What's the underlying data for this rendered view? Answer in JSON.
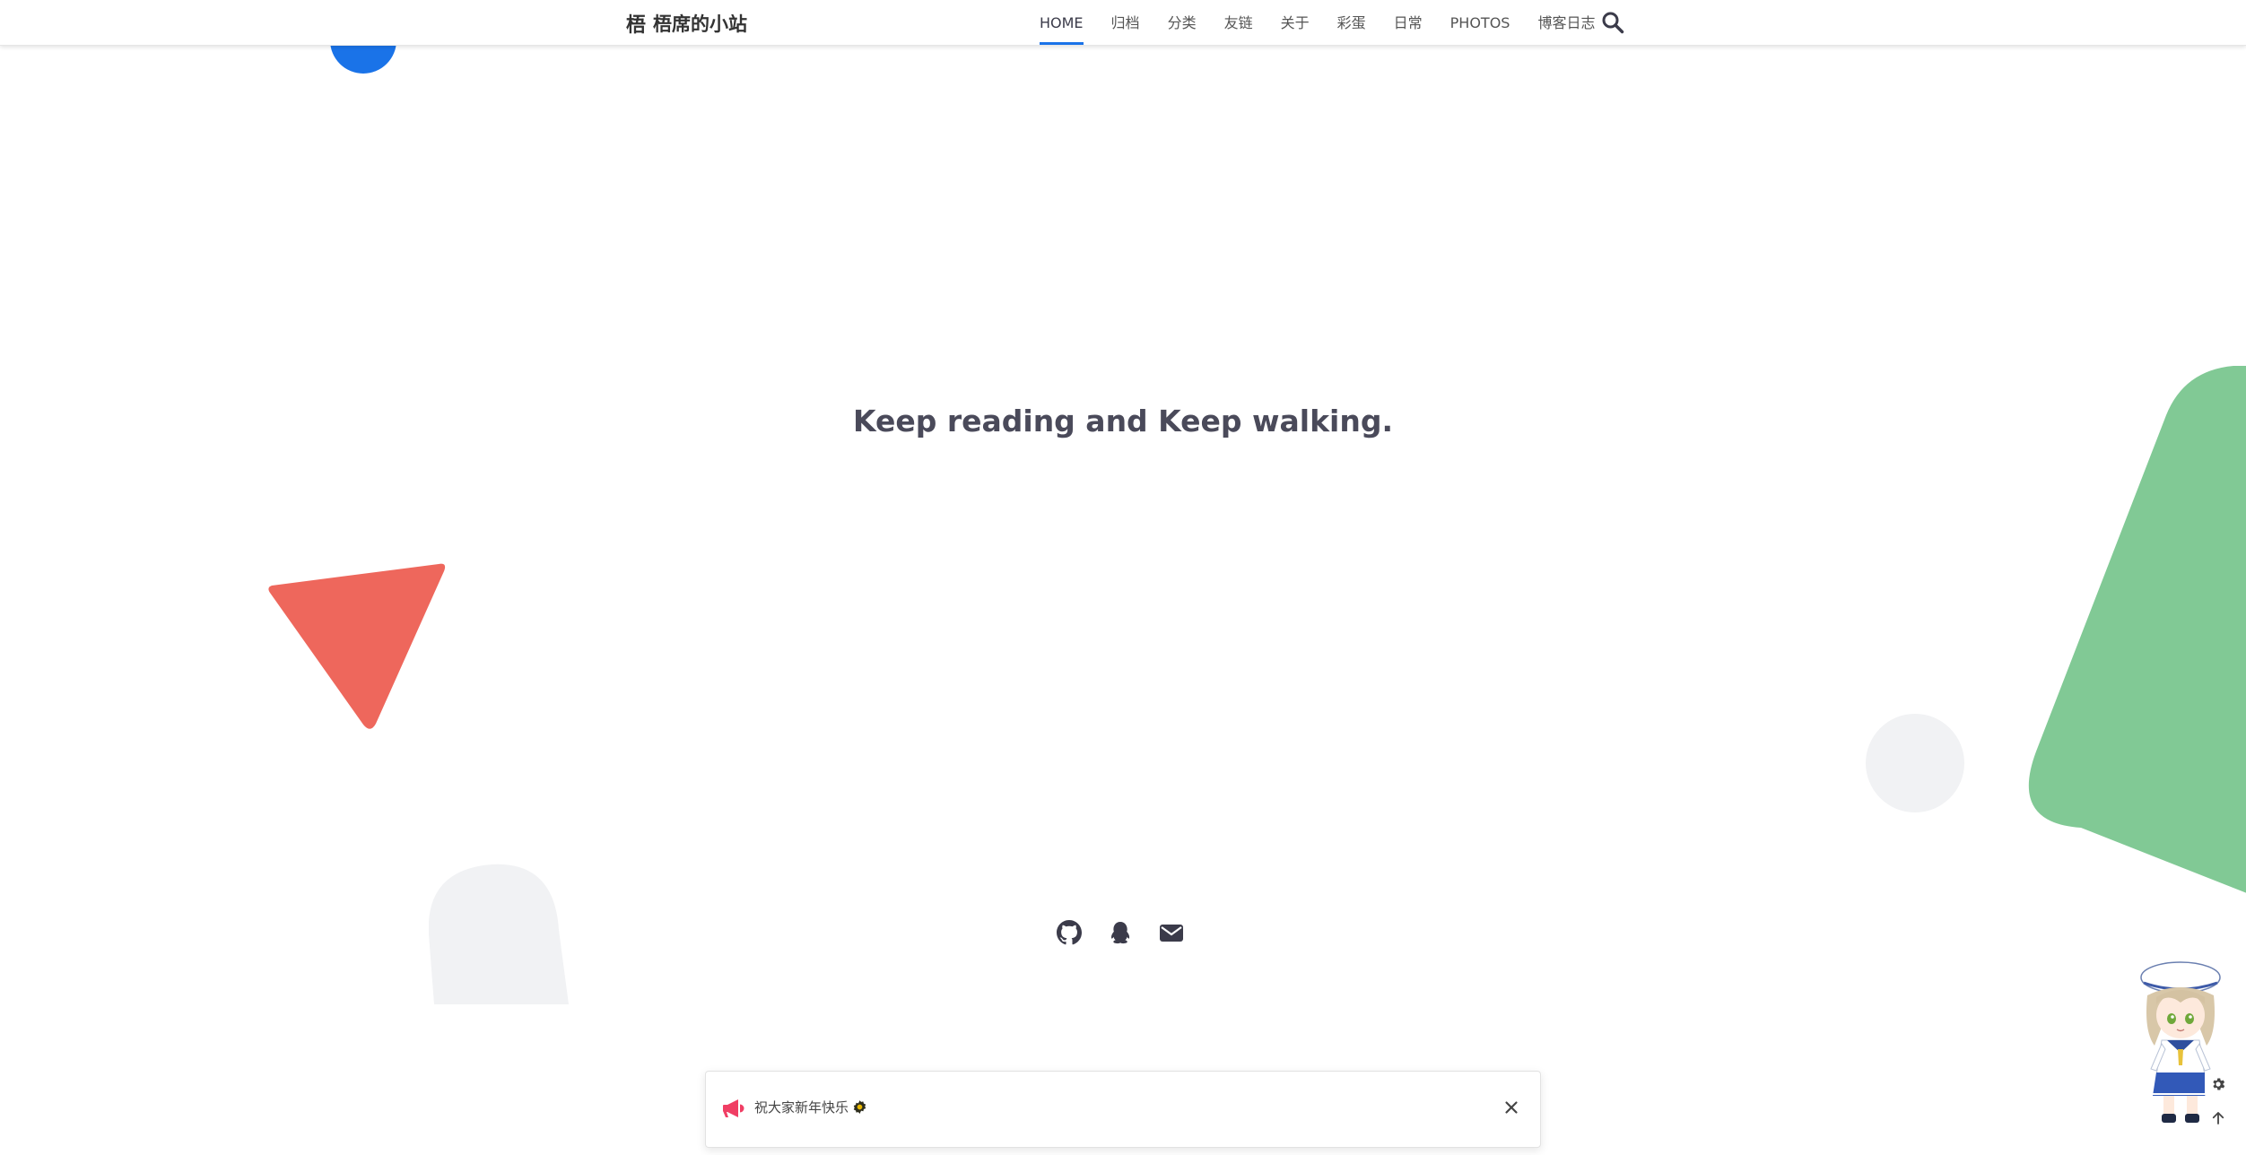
{
  "site": {
    "logo_text": "梧",
    "name": "梧席的小站"
  },
  "nav": {
    "items": [
      {
        "label": "HOME",
        "active": true
      },
      {
        "label": "归档",
        "active": false
      },
      {
        "label": "分类",
        "active": false
      },
      {
        "label": "友链",
        "active": false
      },
      {
        "label": "关于",
        "active": false
      },
      {
        "label": "彩蛋",
        "active": false
      },
      {
        "label": "日常",
        "active": false
      },
      {
        "label": "PHOTOS",
        "active": false
      },
      {
        "label": "博客日志",
        "active": false
      }
    ],
    "search_icon": "search-icon"
  },
  "hero": {
    "subtitle": "Keep reading and Keep walking."
  },
  "social": {
    "icons": [
      "github-icon",
      "qq-icon",
      "mail-icon"
    ]
  },
  "notice": {
    "icon": "megaphone-icon",
    "text": "祝大家新年快乐",
    "trailing_icon": "gear-icon",
    "close_icon": "close-icon"
  },
  "colors": {
    "accent": "#1a73e8",
    "red_shape": "#ee675c",
    "green_shape": "#81c995",
    "gray_shape": "#f1f2f4",
    "notice_icon": "#f03e64"
  },
  "widgets": {
    "settings_icon": "gear-icon",
    "back_to_top_icon": "arrow-up-icon"
  }
}
